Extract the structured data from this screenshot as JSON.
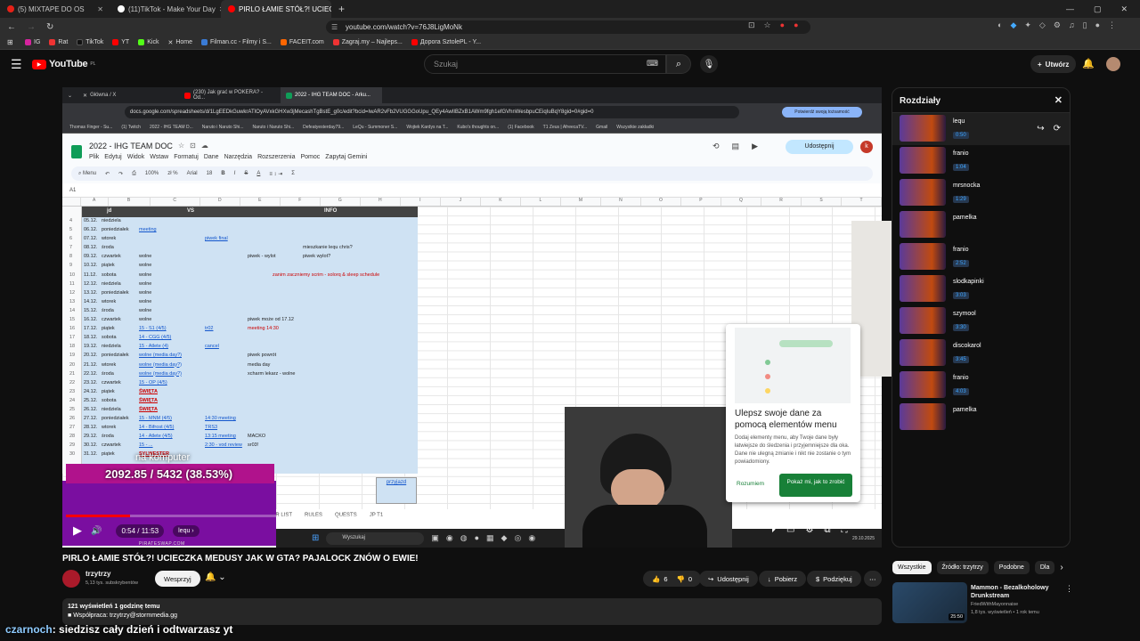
{
  "browser": {
    "tabs": [
      {
        "label": "(5) MIXTAPE DO OS",
        "color": "#e62117"
      },
      {
        "label": "(11)TikTok - Make Your Day",
        "color": "#000000"
      },
      {
        "label": "PIRLO ŁAMIE STÓŁ?! UCIECZK",
        "color": "#ff0000",
        "active": true
      }
    ],
    "url": "youtube.com/watch?v=76J8LigMoNk",
    "bookmarks": [
      "IG",
      "Rat",
      "TikTok",
      "YT",
      "Kick",
      "Home",
      "Filman.cc - Filmy i S...",
      "FACEIT.com",
      "Zagraj.my – Najleps...",
      "Дорога SztolePL - Y..."
    ]
  },
  "youtube": {
    "logo": "YouTube",
    "region": "PL",
    "search_placeholder": "Szukaj",
    "create_label": "Utwórz",
    "video": {
      "title": "PIRLO ŁAMIE STÓŁ?! UCIECZKA MEDUSY JAK W GTA? PAJALOCK ZNÓW O EWIE!",
      "channel": "trzytrzy",
      "subs": "5,13 tys. subskrybentów",
      "support_label": "Wesprzyj",
      "likes": "6",
      "dislikes": "0",
      "share_label": "Udostępnij",
      "download_label": "Pobierz",
      "thanks_label": "Podziękuj",
      "views_line": "121 wyświetleń  1 godzinę temu",
      "collab_line": "Współpraca: trzytrzy@stormmedia.gg"
    },
    "player": {
      "time": "0:54 / 11:53",
      "chapter_chip": "lequ",
      "overlay_progress": "2092.85 / 5432 (38.53%)",
      "overlay_caption": "na komputer",
      "overlay_brand": "PIRATESWAP.COM"
    },
    "chapters_panel": {
      "title": "Rozdziały",
      "items": [
        {
          "name": "lequ",
          "time": "0:50"
        },
        {
          "name": "franio",
          "time": "1:04"
        },
        {
          "name": "mrsnocka",
          "time": "1:29"
        },
        {
          "name": "pamelka",
          "time": ""
        },
        {
          "name": "franio",
          "time": "2:52"
        },
        {
          "name": "slodkapinki",
          "time": "3:03"
        },
        {
          "name": "szymool",
          "time": "3:30"
        },
        {
          "name": "discokarol",
          "time": "3:45"
        },
        {
          "name": "franio",
          "time": "4:03"
        },
        {
          "name": "pamelka",
          "time": ""
        }
      ]
    },
    "filters": [
      "Wszystkie",
      "Źródło: trzytrzy",
      "Podobne",
      "Dla"
    ],
    "recommendation": {
      "title": "Mammon - Bezalkoholowy Drunkstream",
      "channel": "FriedWithMayonnaise",
      "meta": "1,8 tys. wyświetleń • 1 rok temu",
      "duration": "25:50"
    },
    "chat_overlay": {
      "user": "czarnoch",
      "message": ": siedzisz cały dzień i odtwarzasz yt"
    }
  },
  "inner_browser": {
    "tabs": [
      "Główna / X",
      "(230) Jak grać w POKERA? - Od...",
      "2022 - IHG TEAM DOC - Arku..."
    ],
    "url": "docs.google.com/spreadsheets/d/1LgEEDkGuwkrATIOyAVxkGHXw3jMecashTgBstE_g0c/edit?bcid=IwAR2vFb2VUGGGoUpu_QEy4AwIIBZxB1AWm9fgh1efGVhnWesbpuCEiqIuBqY8gid=0#gid=0",
    "verify": "Potwierdź swoją tożsamość",
    "bookmarks": [
      "Thomas Finger - Su...",
      "(1) Twitch",
      "2022 - IHG TEAM D...",
      "Naruto i Naruto Shi...",
      "Naruto i Naruto Shi...",
      "Defeatyesterday79...",
      "LeQu - Summoner S...",
      "Wojtek Kardys na T...",
      "Kubo's thoughts on...",
      "(1) Facebook",
      "T1 Zeus | AfreecaTV...",
      "Gmail",
      "Wszystkie zakładki"
    ]
  },
  "sheet": {
    "title": "2022 - IHG TEAM DOC",
    "menu": [
      "Plik",
      "Edytuj",
      "Widok",
      "Wstaw",
      "Formatuj",
      "Dane",
      "Narzędzia",
      "Rozszerzenia",
      "Pomoc",
      "Zapytaj Gemini"
    ],
    "share_label": "Udostępnij",
    "cell_ref": "A1",
    "zoom": "100%",
    "font": "Arial",
    "font_size": "18",
    "columns": [
      "A",
      "B",
      "C",
      "D",
      "E",
      "F",
      "G",
      "H",
      "I",
      "J",
      "K",
      "L",
      "M",
      "N",
      "O",
      "P",
      "Q",
      "R",
      "S",
      "T"
    ],
    "headers": {
      "jd": "jd",
      "vs": "VS",
      "info": "INFO"
    },
    "rows": [
      {
        "n": "4",
        "date": "05.12.",
        "day": "niedziela",
        "c": "",
        "d": "",
        "e": "",
        "f": ""
      },
      {
        "n": "5",
        "date": "06.12.",
        "day": "poniedziałek",
        "c": "meeting",
        "d": "",
        "e": "",
        "f": ""
      },
      {
        "n": "6",
        "date": "07.12.",
        "day": "wtorek",
        "c": "",
        "d": "piwek final",
        "e": "",
        "f": ""
      },
      {
        "n": "7",
        "date": "08.12.",
        "day": "środa",
        "c": "",
        "d": "",
        "e": "",
        "f": "mieszkanie lequ chris?"
      },
      {
        "n": "8",
        "date": "09.12.",
        "day": "czwartek",
        "c": "wolne",
        "d": "",
        "e": "piwek - wylot",
        "f": "piwek wylot?"
      },
      {
        "n": "9",
        "date": "10.12.",
        "day": "piątek",
        "c": "wolne",
        "d": "",
        "e": "",
        "f": ""
      },
      {
        "n": "10",
        "date": "11.12.",
        "day": "sobota",
        "c": "wolne",
        "d": "",
        "e": "",
        "f": "zanim zaczniemy scrim - solorq & sleep schedule"
      },
      {
        "n": "11",
        "date": "12.12.",
        "day": "niedziela",
        "c": "wolne",
        "d": "",
        "e": "",
        "f": ""
      },
      {
        "n": "12",
        "date": "13.12.",
        "day": "poniedziałek",
        "c": "wolne",
        "d": "",
        "e": "",
        "f": ""
      },
      {
        "n": "13",
        "date": "14.12.",
        "day": "wtorek",
        "c": "wolne",
        "d": "",
        "e": "",
        "f": ""
      },
      {
        "n": "14",
        "date": "15.12.",
        "day": "środa",
        "c": "wolne",
        "d": "",
        "e": "",
        "f": ""
      },
      {
        "n": "15",
        "date": "16.12.",
        "day": "czwartek",
        "c": "wolne",
        "d": "",
        "e": "piwek może od 17.12",
        "f": ""
      },
      {
        "n": "16",
        "date": "17.12.",
        "day": "piątek",
        "c": "15 - S1 (4/5)",
        "d": "tr02",
        "e": "meeting 14:30",
        "f": ""
      },
      {
        "n": "17",
        "date": "18.12.",
        "day": "sobota",
        "c": "14 - CGG (4/5)",
        "d": "",
        "e": "",
        "f": ""
      },
      {
        "n": "18",
        "date": "19.12.",
        "day": "niedziela",
        "c": "15 - Atlete (4)",
        "d": "cancel",
        "e": "",
        "f": ""
      },
      {
        "n": "19",
        "date": "20.12.",
        "day": "poniedziałek",
        "c": "wolne (media day?)",
        "d": "",
        "e": "piwek powrót",
        "f": ""
      },
      {
        "n": "20",
        "date": "21.12.",
        "day": "wtorek",
        "c": "wolne (media day?)",
        "d": "",
        "e": "media day",
        "f": ""
      },
      {
        "n": "21",
        "date": "22.12.",
        "day": "środa",
        "c": "wolne (media day?)",
        "d": "",
        "e": "xcharm lekarz - wolne",
        "f": ""
      },
      {
        "n": "22",
        "date": "23.12.",
        "day": "czwartek",
        "c": "15 - OP (4/5)",
        "d": "",
        "e": "",
        "f": ""
      },
      {
        "n": "23",
        "date": "24.12.",
        "day": "piątek",
        "c": "ŚWIĘTA",
        "d": "",
        "e": "",
        "f": ""
      },
      {
        "n": "24",
        "date": "25.12.",
        "day": "sobota",
        "c": "ŚWIĘTA",
        "d": "",
        "e": "",
        "f": ""
      },
      {
        "n": "25",
        "date": "26.12.",
        "day": "niedziela",
        "c": "ŚWIĘTA",
        "d": "",
        "e": "",
        "f": ""
      },
      {
        "n": "26",
        "date": "27.12.",
        "day": "poniedziałek",
        "c": "15 - MNM (4/5)",
        "d": "14:30 meeting",
        "e": "",
        "f": ""
      },
      {
        "n": "27",
        "date": "28.12.",
        "day": "wtorek",
        "c": "14 - Bifrost (4/5)",
        "d": "TRS3",
        "e": "",
        "f": ""
      },
      {
        "n": "28",
        "date": "29.12.",
        "day": "środa",
        "c": "14 - Atlete (4/5)",
        "d": "13:15 meeting",
        "e": "MACKO",
        "f": ""
      },
      {
        "n": "29",
        "date": "30.12.",
        "day": "czwartek",
        "c": "15 - ...",
        "d": "2:30 - vod review",
        "e": "sr03!",
        "f": ""
      },
      {
        "n": "30",
        "date": "31.12.",
        "day": "piątek",
        "c": "SYLWESTER",
        "d": "",
        "e": "",
        "f": ""
      }
    ],
    "przyjazd": "przyjazd",
    "sheet_tabs": [
      "TIER LIST",
      "RULES",
      "QUESTS",
      "JP T1"
    ],
    "taskbar_search": "Wyszukaj",
    "taskbar_date": "29.10.2025"
  },
  "popup": {
    "title": "Ulepsz swoje dane za pomocą elementów menu",
    "body": "Dodaj elementy menu, aby Twoje dane były łatwiejsze do śledzenia i przyjemniejsze dla oka. Dane nie ulegną zmianie i nikt nie zostanie o tym powiadomiony.",
    "dismiss": "Rozumiem",
    "cta": "Pokaż mi, jak to zrobić"
  }
}
